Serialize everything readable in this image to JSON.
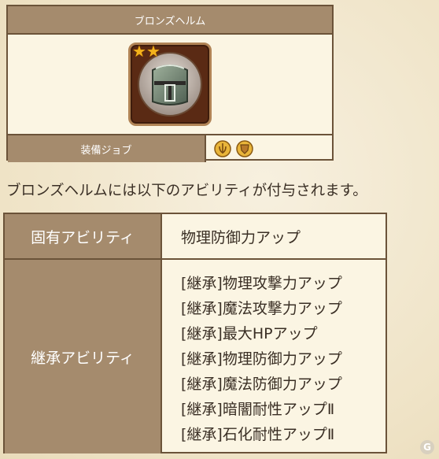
{
  "item": {
    "name": "ブロンズヘルム",
    "stars": 2,
    "job_label": "装備ジョブ",
    "job_icons": [
      "knight-crest-icon",
      "shield-crest-icon"
    ]
  },
  "intro_text": "ブロンズヘルムには以下のアビリティが付与されます。",
  "abilities": {
    "native_header": "固有アビリティ",
    "native_value": "物理防御力アップ",
    "inherited_header": "継承アビリティ",
    "inherited_values": [
      "[継承]物理攻撃力アップ",
      "[継承]魔法攻撃力アップ",
      "[継承]最大HPアップ",
      "[継承]物理防御力アップ",
      "[継承]魔法防御力アップ",
      "[継承]暗闇耐性アップⅡ",
      "[継承]石化耐性アップⅡ"
    ]
  },
  "watermark": "G"
}
